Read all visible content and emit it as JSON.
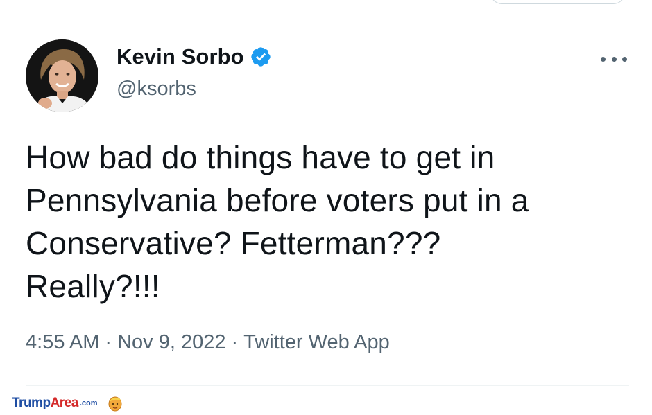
{
  "tweet": {
    "author": {
      "display_name": "Kevin Sorbo",
      "handle": "@ksorbs",
      "verified": true,
      "verified_color": "#1d9bf0"
    },
    "text": "How bad do things have to get in\nPennsylvania before voters put in a\nConservative?  Fetterman???\nReally?!!!",
    "meta": {
      "time": "4:55 AM",
      "separator": "·",
      "date": "Nov 9, 2022",
      "source": "Twitter Web App"
    }
  },
  "icons": {
    "more": "more-horizontal-icon",
    "verified": "verified-badge-icon"
  },
  "watermark": {
    "part1": "Trump",
    "part2": "Area",
    "part3": ".com"
  },
  "colors": {
    "text_primary": "#0f1419",
    "text_secondary": "#536471",
    "watermark_blue": "#1f4ea3",
    "watermark_red": "#d42a2a"
  }
}
